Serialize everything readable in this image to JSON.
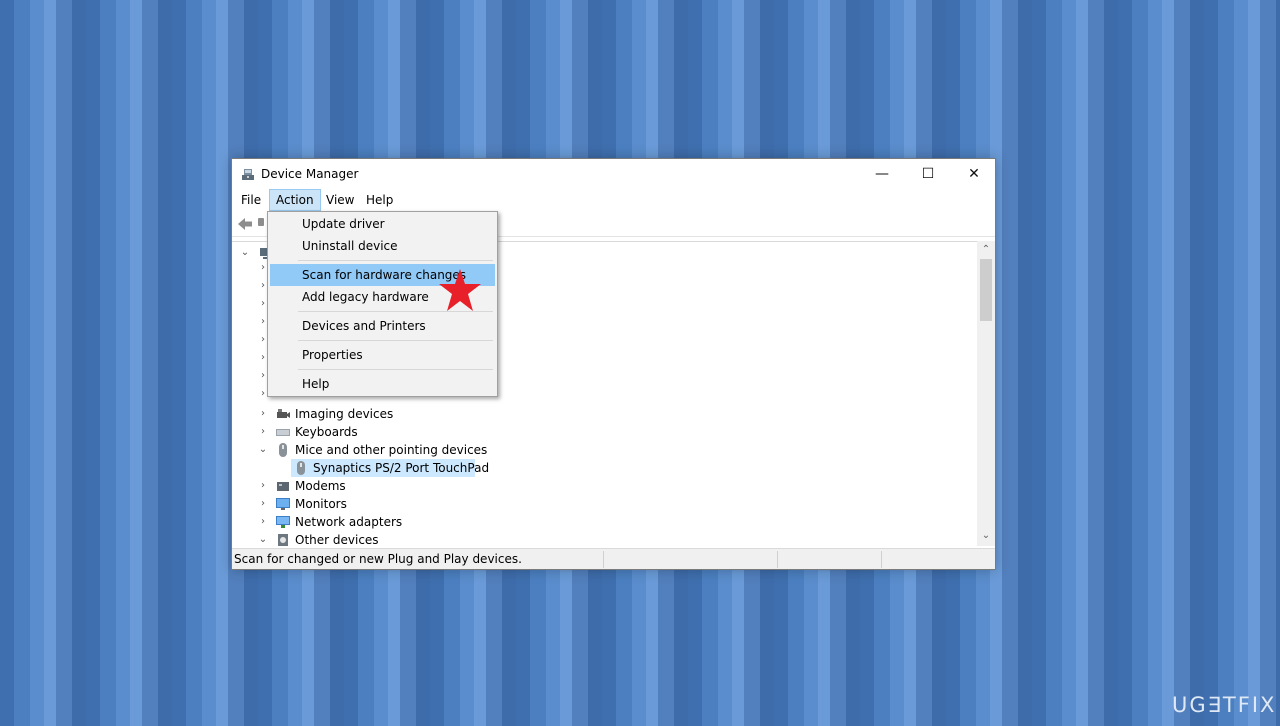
{
  "window": {
    "title": "Device Manager",
    "controls": {
      "minimize": "—",
      "maximize": "☐",
      "close": "✕"
    }
  },
  "menubar": {
    "items": [
      {
        "label": "File"
      },
      {
        "label": "Action",
        "active": true
      },
      {
        "label": "View"
      },
      {
        "label": "Help"
      }
    ]
  },
  "action_menu": {
    "items": [
      {
        "label": "Update driver"
      },
      {
        "label": "Uninstall device"
      },
      {
        "label": "Scan for hardware changes",
        "highlighted": true
      },
      {
        "label": "Add legacy hardware"
      },
      {
        "label": "Devices and Printers"
      },
      {
        "label": "Properties"
      },
      {
        "label": "Help"
      }
    ]
  },
  "tree": {
    "items": [
      {
        "label": "Imaging devices",
        "icon": "camera-icon",
        "expanded": false
      },
      {
        "label": "Keyboards",
        "icon": "keyboard-icon",
        "expanded": false
      },
      {
        "label": "Mice and other pointing devices",
        "icon": "mouse-icon",
        "expanded": true
      },
      {
        "label": "Synaptics PS/2 Port TouchPad",
        "icon": "mouse-icon",
        "child": true,
        "selected": true
      },
      {
        "label": "Modems",
        "icon": "modem-icon",
        "expanded": false
      },
      {
        "label": "Monitors",
        "icon": "monitor-icon",
        "expanded": false
      },
      {
        "label": "Network adapters",
        "icon": "network-icon",
        "expanded": false
      },
      {
        "label": "Other devices",
        "icon": "unknown-device-icon",
        "expanded": true
      }
    ]
  },
  "statusbar": {
    "text": "Scan for changed or new Plug and Play devices."
  },
  "watermark": {
    "text": "UG∃TFIX"
  },
  "colors": {
    "menu_highlight": "#91c9f7",
    "active_menu": "#cce4f7",
    "selection": "#cce8ff",
    "star": "#e8202a"
  }
}
